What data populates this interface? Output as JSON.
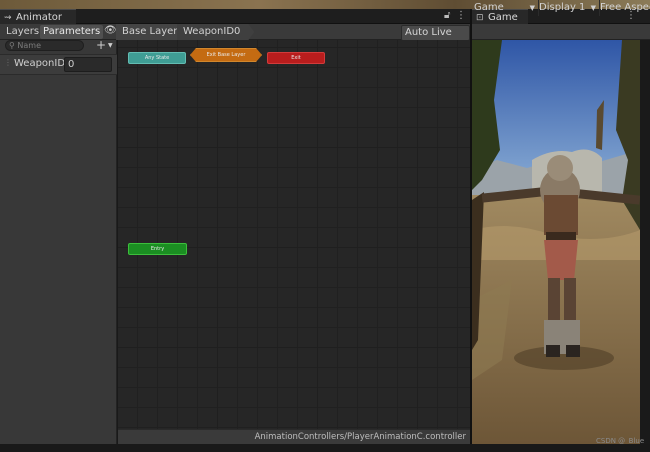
{
  "animator": {
    "tab_label": "Animator",
    "tab_icon": "animator-icon",
    "subtabs": {
      "layers": "Layers",
      "parameters": "Parameters"
    },
    "breadcrumbs": [
      "Base Layer",
      "WeaponID0"
    ],
    "auto_live_link": "Auto Live Link",
    "search_placeholder": "Name",
    "parameters": [
      {
        "name": "WeaponID",
        "value": "0"
      }
    ],
    "nodes": {
      "any_state": "Any State",
      "exit_base_layer": "Exit Base Layer",
      "exit": "Exit",
      "entry": "Entry"
    },
    "status_path": "AnimationControllers/PlayerAnimationC.controller"
  },
  "game": {
    "tab_label": "Game",
    "tab_icon": "gamepad-icon",
    "view_dropdown": "Game",
    "display_dropdown": "Display 1",
    "aspect_dropdown": "Free Aspect",
    "watermark": "CSDN @_Blue"
  },
  "colors": {
    "any_state": "#3f9d94",
    "exit_base_layer": "#c46b12",
    "exit": "#b91d1d",
    "entry": "#1b8e22",
    "editor_bg": "#383838",
    "graph_bg": "#262626"
  }
}
